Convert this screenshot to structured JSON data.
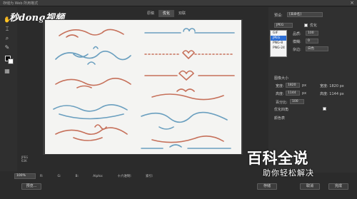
{
  "window": {
    "title": "存储为 Web 所用格式",
    "close_icon": "close-icon"
  },
  "logo": {
    "text": "秒dong视频"
  },
  "tabs": [
    {
      "label": "原稿"
    },
    {
      "label": "优化"
    },
    {
      "label": "双联"
    }
  ],
  "file_info": {
    "format": "JPEG",
    "size": "63K"
  },
  "statusbar": {
    "zoom": "100%",
    "r_label": "R:",
    "g_label": "G:",
    "b_label": "B:",
    "alpha_label": "Alpha:",
    "hex_label": "十六进制:",
    "index_label": "索引:"
  },
  "buttons": {
    "preview": "预览...",
    "save": "存储",
    "cancel": "取消",
    "done": "完成"
  },
  "panel": {
    "preset_label": "预设:",
    "preset_value": "[未命名]",
    "format_value": "JPEG",
    "optimized_label": "优化",
    "quality_label": "品质:",
    "quality_value": "100",
    "blur_label": "模糊:",
    "blur_value": "0",
    "matte_label": "杂边:",
    "matte_value": "白色",
    "image_size_label": "图像大小",
    "width_label": "宽度:",
    "width_value": "1820",
    "height_label": "高度:",
    "height_value": "1144",
    "percent_label": "百分比:",
    "percent_value": "100",
    "px_unit": "px",
    "quality_mode": "优化四角",
    "width_px": "宽度: 1820 px",
    "height_px": "高度: 1144 px",
    "color_table_label": "颜色表",
    "format_options": [
      "GIF",
      "JPEG",
      "PNG-8",
      "PNG-24"
    ],
    "selected_format": "JPEG"
  },
  "watermark": {
    "title": "百科全说",
    "subtitle": "助你轻松解决"
  },
  "colors": {
    "ornament_red": "#c6705a",
    "ornament_blue": "#6a9fbf",
    "canvas_bg": "#f4f4f2"
  }
}
